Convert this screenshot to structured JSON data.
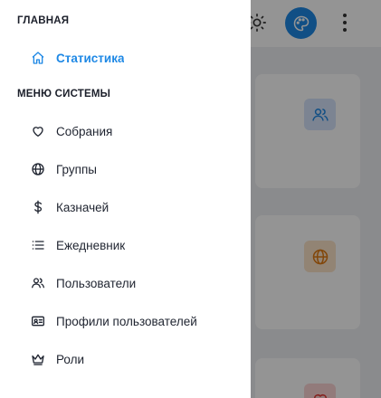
{
  "colors": {
    "accent": "#1e88e5",
    "text": "#1f2430",
    "card_icon_blue": "#d6e4fb",
    "card_icon_orange": "#fbe3c8",
    "card_icon_red": "#fbd5d5"
  },
  "header": {
    "theme_icon": "sun-icon",
    "avatar_icon": "palette-icon",
    "menu_icon": "more-vertical-icon"
  },
  "sidebar": {
    "main_title": "ГЛАВНАЯ",
    "main_items": [
      {
        "label": "Статистика",
        "icon": "home-icon",
        "active": true
      }
    ],
    "system_title": "МЕНЮ СИСТЕМЫ",
    "system_items": [
      {
        "label": "Собрания",
        "icon": "heart-icon"
      },
      {
        "label": "Группы",
        "icon": "globe-icon"
      },
      {
        "label": "Казначей",
        "icon": "dollar-icon"
      },
      {
        "label": "Ежедневник",
        "icon": "list-icon"
      },
      {
        "label": "Пользователи",
        "icon": "users-icon"
      },
      {
        "label": "Профили пользователей",
        "icon": "id-card-icon"
      },
      {
        "label": "Роли",
        "icon": "crown-icon"
      }
    ]
  },
  "cards": [
    {
      "icon": "users-icon"
    },
    {
      "icon": "globe-icon"
    },
    {
      "icon": "heart-icon"
    }
  ]
}
